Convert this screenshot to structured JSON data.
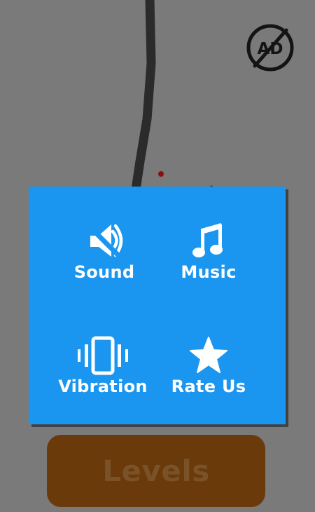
{
  "header": {
    "no_ads_label": "AD",
    "no_ads_icon": "no-ads-icon"
  },
  "settings": {
    "sound_label": "Sound",
    "sound_icon": "speaker-muted-icon",
    "music_label": "Music",
    "music_icon": "music-note-icon",
    "vibration_label": "Vibration",
    "vibration_icon": "vibration-phone-icon",
    "rate_label": "Rate Us",
    "rate_icon": "star-icon"
  },
  "footer": {
    "levels_label": "Levels"
  },
  "colors": {
    "overlay": "#7a7a7a",
    "panel": "#1a96f0",
    "levels_button": "#6b3a0a",
    "levels_text": "#7a5227",
    "rope": "#2b2b2b",
    "dot": "#8a1010"
  }
}
